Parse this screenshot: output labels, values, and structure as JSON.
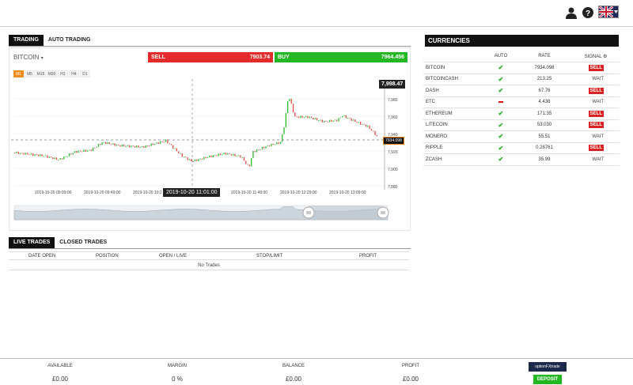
{
  "trading_tabs": [
    "TRADING",
    "AUTO TRADING"
  ],
  "asset": "BITCOIN",
  "sell": {
    "label": "SELL",
    "price": "7903.74"
  },
  "buy": {
    "label": "BUY",
    "price": "7964.456"
  },
  "timeframes": [
    "M1",
    "M5",
    "M15",
    "M30",
    "H1",
    "H4",
    "D1"
  ],
  "chart": {
    "high_label": "7,998.47",
    "current_label": "7934.098",
    "crosshair_time": "2019-10-20 11:01:00",
    "y_ticks": [
      "7,980",
      "7,960",
      "7,940",
      "7,920",
      "7,900",
      "7,880"
    ],
    "x_ticks": [
      "2019-10-20 09:09:00",
      "2019-10-20 09:49:00",
      "2019-10-20 10:2",
      "2019-10-20 11:49:00",
      "2019-10-20 12:29:00",
      "2019-10-20 13:09:00"
    ]
  },
  "currencies": {
    "title": "CURRENCIES",
    "columns": [
      "AUTO",
      "RATE",
      "SIGNAL"
    ],
    "rows": [
      {
        "name": "BITCOIN",
        "auto": "check",
        "rate": "7934.098",
        "signal": "SELL"
      },
      {
        "name": "BITCOINCASH",
        "auto": "check",
        "rate": "213.25",
        "signal": "WAIT"
      },
      {
        "name": "DASH",
        "auto": "check",
        "rate": "67.76",
        "signal": "SELL"
      },
      {
        "name": "ETC",
        "auto": "dash",
        "rate": "4.438",
        "signal": "WAIT"
      },
      {
        "name": "ETHEREUM",
        "auto": "check",
        "rate": "171.35",
        "signal": "SELL"
      },
      {
        "name": "LITECOIN",
        "auto": "check",
        "rate": "53.030",
        "signal": "SELL"
      },
      {
        "name": "MONERO",
        "auto": "check",
        "rate": "55.51",
        "signal": "WAIT"
      },
      {
        "name": "RIPPLE",
        "auto": "check",
        "rate": "0.28761",
        "signal": "SELL"
      },
      {
        "name": "ZCASH",
        "auto": "check",
        "rate": "35.99",
        "signal": "WAIT"
      }
    ]
  },
  "trades": {
    "tabs": [
      "LIVE TRADES",
      "CLOSED TRADES"
    ],
    "columns": [
      "DATE OPEN",
      "POSITION",
      "OPEN / LIVE",
      "STOP/LIMIT",
      "PROFIT"
    ],
    "empty": "No Trades"
  },
  "footer": {
    "available": {
      "label": "AVAILABLE",
      "value": "£0.00"
    },
    "margin": {
      "label": "MARGIN",
      "value": "0 %"
    },
    "balance": {
      "label": "BALANCE",
      "value": "£0.00"
    },
    "profit": {
      "label": "PROFIT",
      "value": "£0.00"
    },
    "logo": "optionFXtrade",
    "deposit": "DEPOSIT"
  }
}
